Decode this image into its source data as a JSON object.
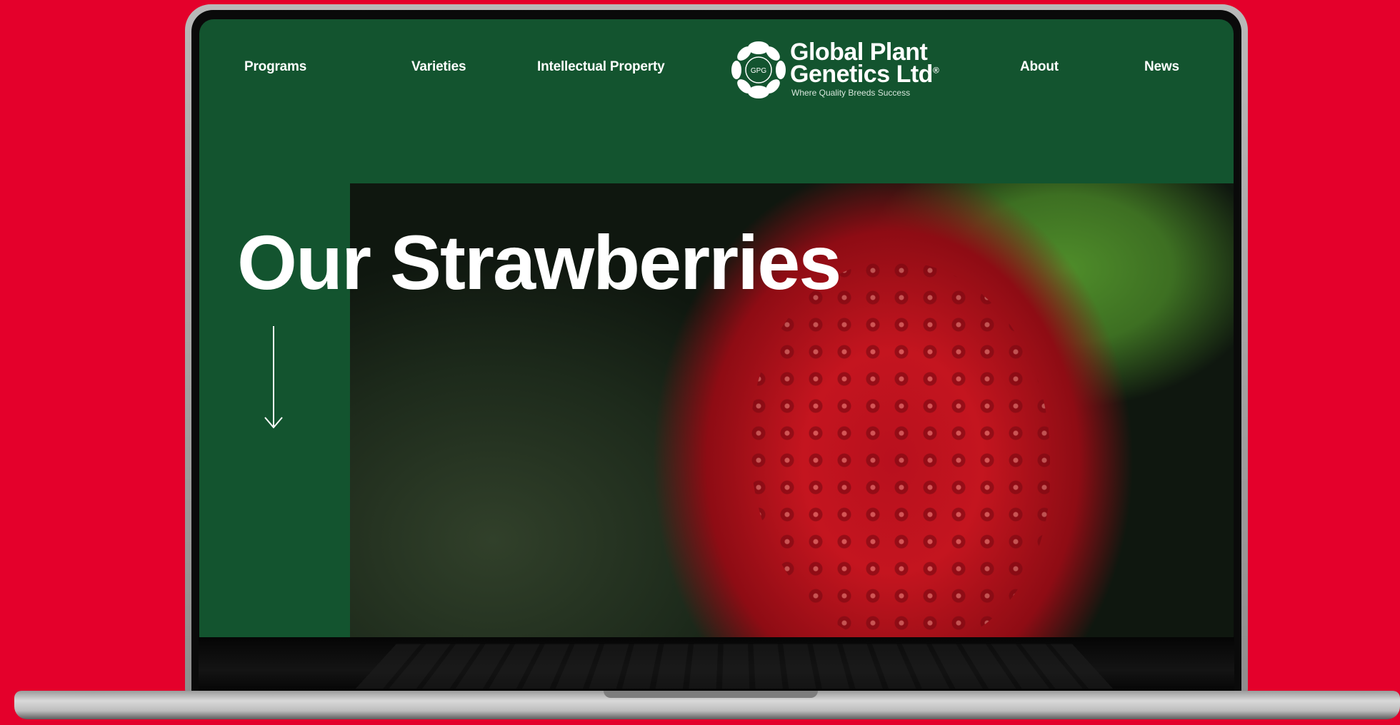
{
  "nav": {
    "programs": "Programs",
    "varieties": "Varieties",
    "ip": "Intellectual Property",
    "about": "About",
    "news": "News"
  },
  "logo": {
    "mark_text": "GPG",
    "line1": "Global Plant",
    "line2": "Genetics Ltd",
    "registered": "®",
    "tagline": "Where Quality Breeds Success"
  },
  "hero": {
    "title": "Our Strawberries",
    "scroll_icon": "arrow-down-icon"
  },
  "colors": {
    "background": "#e4002b",
    "site_green": "#13542f",
    "text": "#ffffff"
  }
}
